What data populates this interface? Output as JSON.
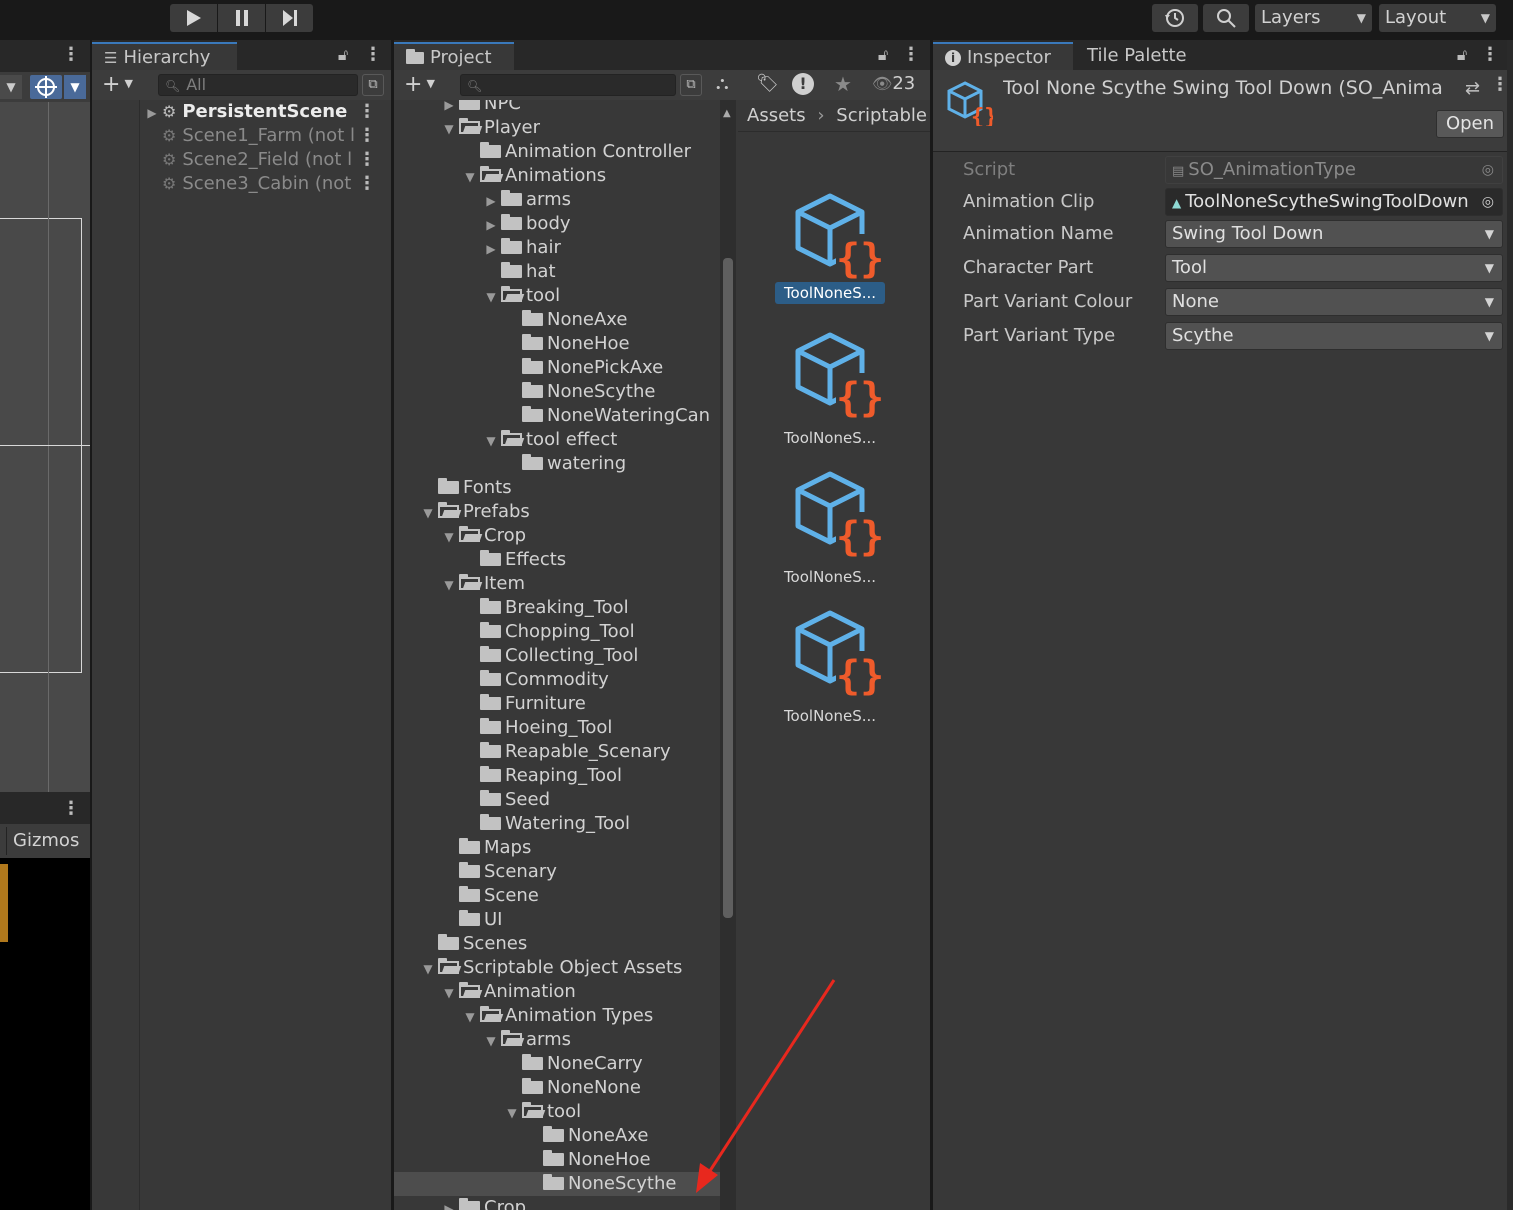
{
  "toolbar": {
    "play_icon": "play-icon",
    "pause_icon": "pause-icon",
    "step_icon": "step-icon",
    "history_icon": "history-icon",
    "search_icon": "search-icon",
    "layers_label": "Layers",
    "layout_label": "Layout"
  },
  "scene": {
    "gizmos_label": "Gizmos"
  },
  "hierarchy": {
    "tab_label": "Hierarchy",
    "search_placeholder": "All",
    "items": [
      {
        "label": "PersistentScene"
      },
      {
        "label": "Scene1_Farm (not l"
      },
      {
        "label": "Scene2_Field (not l"
      },
      {
        "label": "Scene3_Cabin (not"
      }
    ]
  },
  "project": {
    "tab_label": "Project",
    "hidden_count": "23",
    "breadcrumb": [
      "Assets",
      "Scriptable C"
    ],
    "tree": [
      {
        "label": "NPC"
      },
      {
        "label": "Player"
      },
      {
        "label": "Animation Controller"
      },
      {
        "label": "Animations"
      },
      {
        "label": "arms"
      },
      {
        "label": "body"
      },
      {
        "label": "hair"
      },
      {
        "label": "hat"
      },
      {
        "label": "tool"
      },
      {
        "label": "NoneAxe"
      },
      {
        "label": "NoneHoe"
      },
      {
        "label": "NonePickAxe"
      },
      {
        "label": "NoneScythe"
      },
      {
        "label": "NoneWateringCan"
      },
      {
        "label": "tool effect"
      },
      {
        "label": "watering"
      },
      {
        "label": "Fonts"
      },
      {
        "label": "Prefabs"
      },
      {
        "label": "Crop"
      },
      {
        "label": "Effects"
      },
      {
        "label": "Item"
      },
      {
        "label": "Breaking_Tool"
      },
      {
        "label": "Chopping_Tool"
      },
      {
        "label": "Collecting_Tool"
      },
      {
        "label": "Commodity"
      },
      {
        "label": "Furniture"
      },
      {
        "label": "Hoeing_Tool"
      },
      {
        "label": "Reapable_Scenary"
      },
      {
        "label": "Reaping_Tool"
      },
      {
        "label": "Seed"
      },
      {
        "label": "Watering_Tool"
      },
      {
        "label": "Maps"
      },
      {
        "label": "Scenary"
      },
      {
        "label": "Scene"
      },
      {
        "label": "UI"
      },
      {
        "label": "Scenes"
      },
      {
        "label": "Scriptable Object Assets"
      },
      {
        "label": "Animation"
      },
      {
        "label": "Animation Types"
      },
      {
        "label": "arms"
      },
      {
        "label": "NoneCarry"
      },
      {
        "label": "NoneNone"
      },
      {
        "label": "tool"
      },
      {
        "label": "NoneAxe"
      },
      {
        "label": "NoneHoe"
      },
      {
        "label": "NoneScythe"
      },
      {
        "label": "Crop"
      }
    ],
    "assets": [
      {
        "label": "ToolNoneS..."
      },
      {
        "label": "ToolNoneS..."
      },
      {
        "label": "ToolNoneS..."
      },
      {
        "label": "ToolNoneS..."
      }
    ]
  },
  "inspector": {
    "tab_label": "Inspector",
    "tab2_label": "Tile Palette",
    "title": "Tool None Scythe Swing Tool Down (SO_Anima",
    "open_label": "Open",
    "fields": [
      {
        "label": "Script",
        "value": "SO_AnimationType"
      },
      {
        "label": "Animation Clip",
        "value": "ToolNoneScytheSwingToolDown"
      },
      {
        "label": "Animation Name",
        "value": "Swing Tool Down"
      },
      {
        "label": "Character Part",
        "value": "Tool"
      },
      {
        "label": "Part Variant Colour",
        "value": "None"
      },
      {
        "label": "Part Variant Type",
        "value": "Scythe"
      }
    ]
  },
  "colors": {
    "accent": "#3a79bb",
    "selection": "#2c5d87",
    "arrow": "#e8281e",
    "script_blue": "#5fb1e8",
    "script_orange": "#ef5b2b"
  }
}
